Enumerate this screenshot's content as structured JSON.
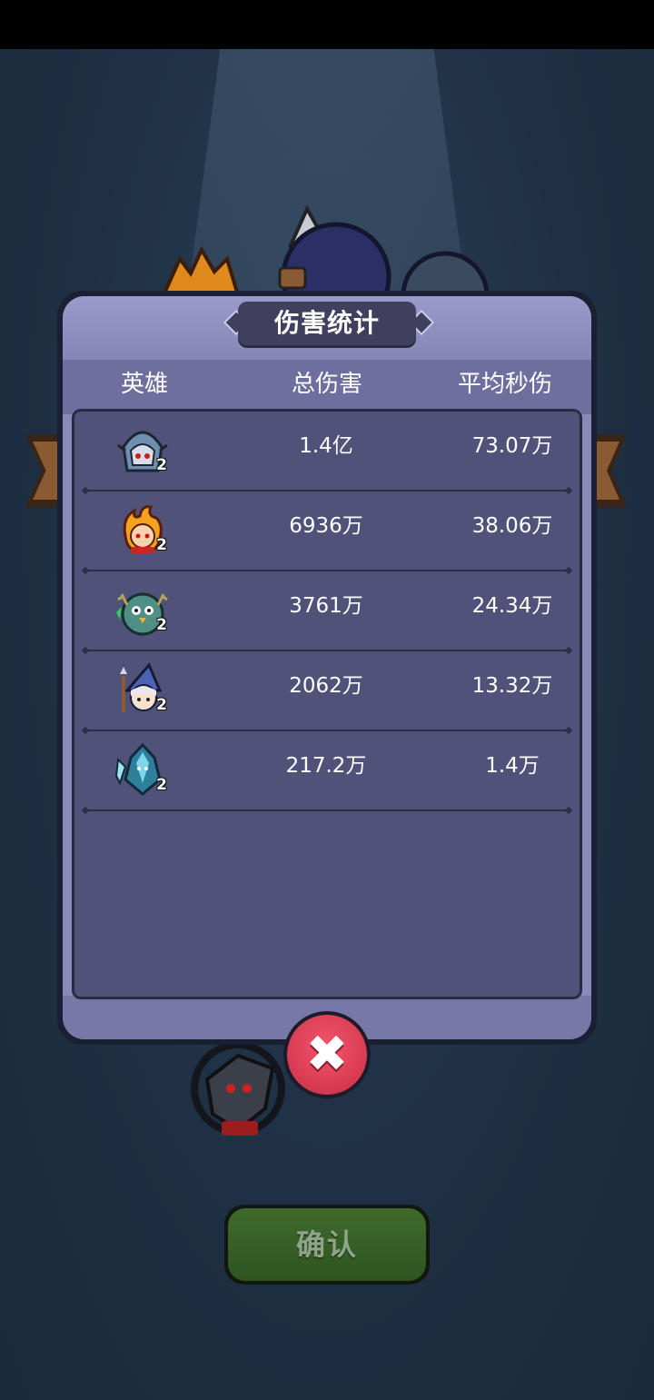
{
  "dialog": {
    "title": "伤害统计",
    "columns": {
      "hero": "英雄",
      "total_damage": "总伤害",
      "avg_dps": "平均秒伤"
    },
    "rows": [
      {
        "hero_icon": "dark-knight-hero-icon",
        "level": "2",
        "total_damage": "1.4亿",
        "avg_dps": "73.07万"
      },
      {
        "hero_icon": "fire-spirit-hero-icon",
        "level": "2",
        "total_damage": "6936万",
        "avg_dps": "38.06万"
      },
      {
        "hero_icon": "forest-owl-hero-icon",
        "level": "2",
        "total_damage": "3761万",
        "avg_dps": "24.34万"
      },
      {
        "hero_icon": "mage-girl-hero-icon",
        "level": "2",
        "total_damage": "2062万",
        "avg_dps": "13.32万"
      },
      {
        "hero_icon": "ice-warrior-hero-icon",
        "level": "2",
        "total_damage": "217.2万",
        "avg_dps": "1.4万"
      }
    ]
  },
  "close_button_icon": "close-x-icon",
  "confirm_button": {
    "label": "确认"
  }
}
